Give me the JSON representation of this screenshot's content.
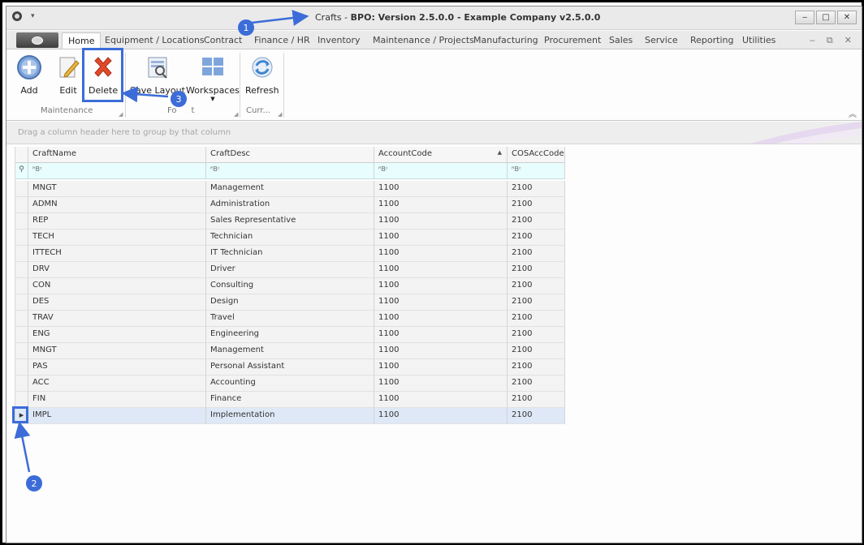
{
  "window": {
    "title_prefix": "Crafts - ",
    "title_main": "BPO: Version 2.5.0.0 - Example Company v2.5.0.0",
    "buttons": [
      "‒",
      "□",
      "✕"
    ]
  },
  "tabs": {
    "active": "Home",
    "items": [
      "Equipment / Locations",
      "Contract",
      "Finance / HR",
      "Inventory",
      "Maintenance / Projects",
      "Manufacturing",
      "Procurement",
      "Sales",
      "Service",
      "Reporting",
      "Utilities"
    ],
    "mdi": [
      "‒",
      "⧉",
      "✕"
    ]
  },
  "ribbon": {
    "add": "Add",
    "edit": "Edit",
    "delete": "Delete",
    "save_layout": "Save Layout",
    "workspaces": "Workspaces",
    "refresh": "Refresh",
    "group_maintenance": "Maintenance",
    "group_format": "Fo",
    "group_format_tail": "t",
    "group_current": "Curr..."
  },
  "group_panel": "Drag a column header here to group by that column",
  "grid": {
    "columns": [
      "CraftName",
      "CraftDesc",
      "AccountCode",
      "COSAccCode"
    ],
    "filter_glyph": "ᴿBᶜ",
    "rows": [
      [
        "MNGT",
        "Management",
        "1100",
        "2100"
      ],
      [
        "ADMN",
        "Administration",
        "1100",
        "2100"
      ],
      [
        "REP",
        "Sales Representative",
        "1100",
        "2100"
      ],
      [
        "TECH",
        "Technician",
        "1100",
        "2100"
      ],
      [
        "ITTECH",
        "IT Technician",
        "1100",
        "2100"
      ],
      [
        "DRV",
        "Driver",
        "1100",
        "2100"
      ],
      [
        "CON",
        "Consulting",
        "1100",
        "2100"
      ],
      [
        "DES",
        "Design",
        "1100",
        "2100"
      ],
      [
        "TRAV",
        "Travel",
        "1100",
        "2100"
      ],
      [
        "ENG",
        "Engineering",
        "1100",
        "2100"
      ],
      [
        "MNGT",
        "Management",
        "1100",
        "2100"
      ],
      [
        "PAS",
        "Personal Assistant",
        "1100",
        "2100"
      ],
      [
        "ACC",
        "Accounting",
        "1100",
        "2100"
      ],
      [
        "FIN",
        "Finance",
        "1100",
        "2100"
      ],
      [
        "IMPL",
        "Implementation",
        "1100",
        "2100"
      ]
    ],
    "selected_row": 14
  },
  "callouts": [
    "1",
    "2",
    "3"
  ],
  "colors": {
    "annotation": "#3c6cd8",
    "delete_icon": "#e04a2a",
    "selected_row": "#dfe8f6",
    "filter_row": "#e8fdfd"
  }
}
